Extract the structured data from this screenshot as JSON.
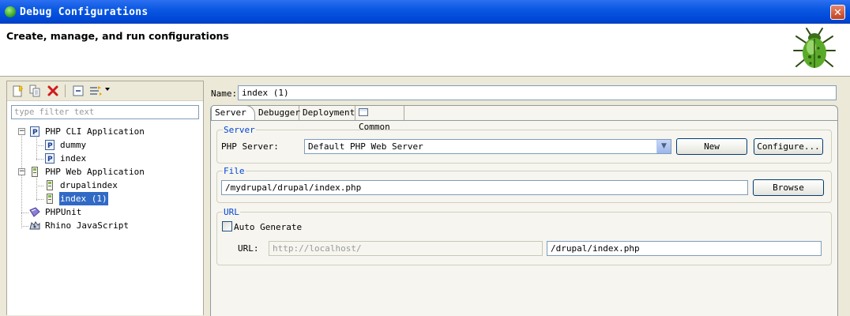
{
  "window": {
    "title": "Debug Configurations",
    "close_glyph": "✕"
  },
  "header": {
    "title": "Create, manage, and run configurations",
    "icon": "bug-icon"
  },
  "left_panel": {
    "toolbar": [
      "new-configuration-icon",
      "duplicate-icon",
      "delete-icon",
      "collapse-all-icon",
      "filter-icon"
    ],
    "filter_placeholder": "type filter text",
    "tree": [
      {
        "label": "PHP CLI Application",
        "expanded": true,
        "children": [
          {
            "label": "dummy"
          },
          {
            "label": "index"
          }
        ]
      },
      {
        "label": "PHP Web Application",
        "expanded": true,
        "children": [
          {
            "label": "drupalindex"
          },
          {
            "label": "index (1)",
            "selected": true
          }
        ]
      },
      {
        "label": "PHPUnit"
      },
      {
        "label": "Rhino JavaScript"
      }
    ],
    "expander_glyph": "−"
  },
  "right_panel": {
    "name_label": "Name:",
    "name_value": "index (1)",
    "tabs": [
      {
        "label": "Server",
        "active": true
      },
      {
        "label": "Debugger"
      },
      {
        "label": "Deployment"
      },
      {
        "label": "Common",
        "icon": "common-tab-icon"
      }
    ],
    "server_group": {
      "title": "Server",
      "label": "PHP Server:",
      "selected": "Default PHP Web Server",
      "dropdown_glyph": "▼",
      "new_button": "New",
      "configure_button": "Configure..."
    },
    "file_group": {
      "title": "File",
      "path": "/mydrupal/drupal/index.php",
      "browse_button": "Browse"
    },
    "url_group": {
      "title": "URL",
      "auto_generate_label": "Auto Generate",
      "auto_generate_checked": false,
      "url_label": "URL:",
      "base_url": "http://localhost/",
      "path": "/drupal/index.php"
    }
  },
  "colors": {
    "title_bar": "#0a58e2",
    "selection": "#316ac5",
    "group_title": "#0046d5",
    "dialog_bg": "#ece9d8"
  }
}
